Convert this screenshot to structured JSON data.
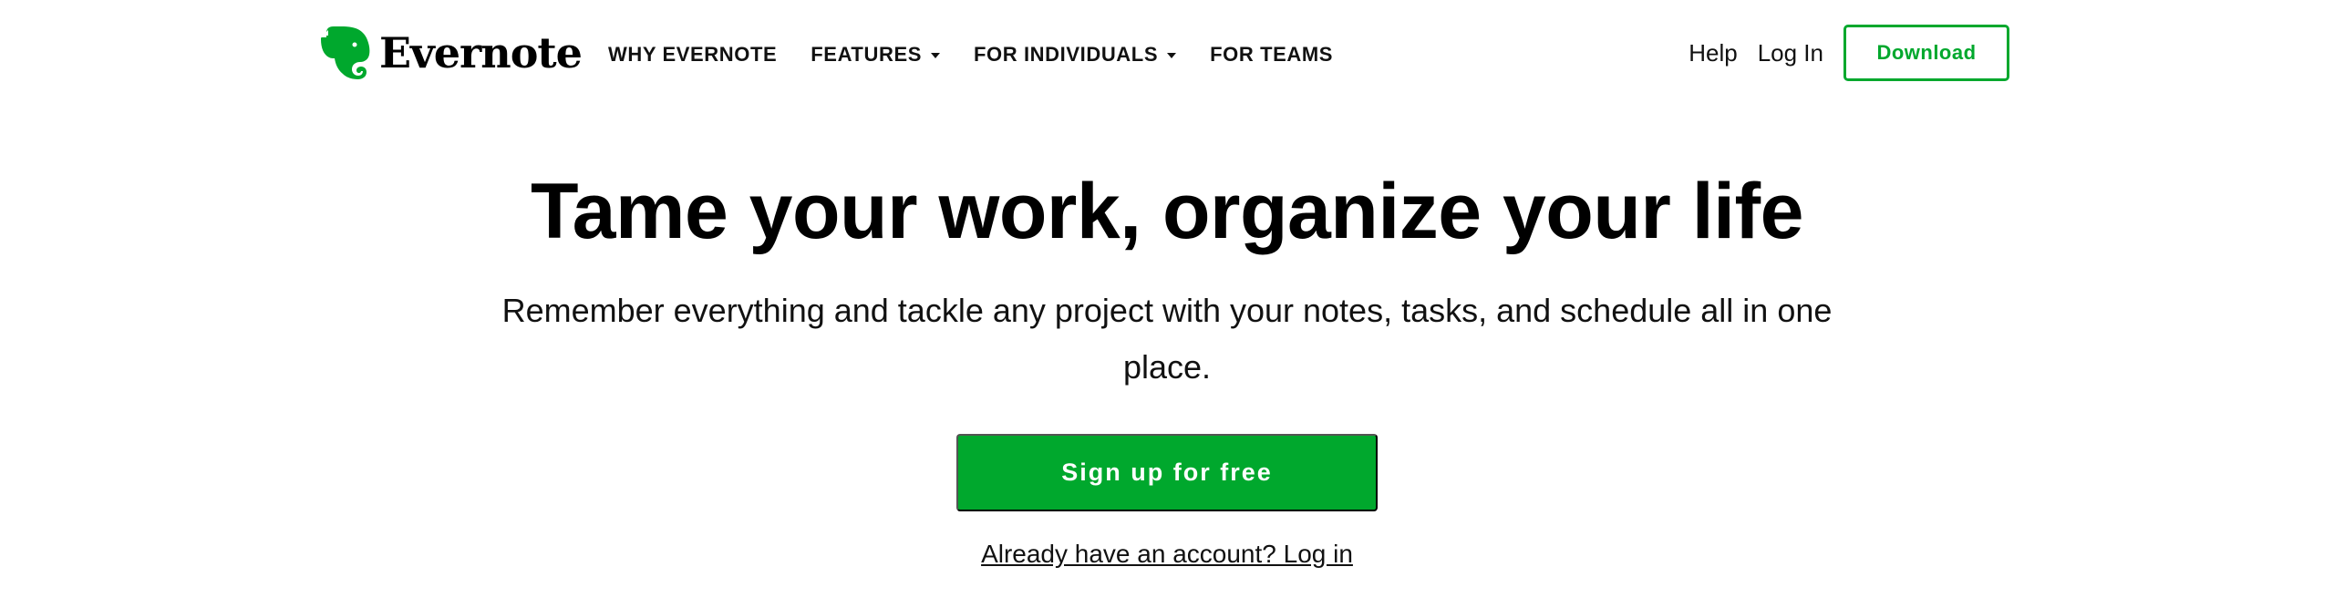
{
  "header": {
    "logo": {
      "text": "Evernote",
      "icon": "evernote-elephant-icon",
      "color": "#00a82d"
    },
    "nav": [
      {
        "label": "WHY EVERNOTE",
        "has_dropdown": false
      },
      {
        "label": "FEATURES",
        "has_dropdown": true
      },
      {
        "label": "FOR INDIVIDUALS",
        "has_dropdown": true
      },
      {
        "label": "FOR TEAMS",
        "has_dropdown": false
      }
    ],
    "help_label": "Help",
    "login_label": "Log In",
    "download_label": "Download"
  },
  "hero": {
    "title": "Tame your work, organize your life",
    "subtitle": "Remember everything and tackle any project with your notes, tasks, and schedule all in one place.",
    "signup_label": "Sign up for free",
    "account_link": "Already have an account? Log in"
  },
  "colors": {
    "brand_green": "#00a82d",
    "text": "#000000",
    "background": "#ffffff"
  }
}
